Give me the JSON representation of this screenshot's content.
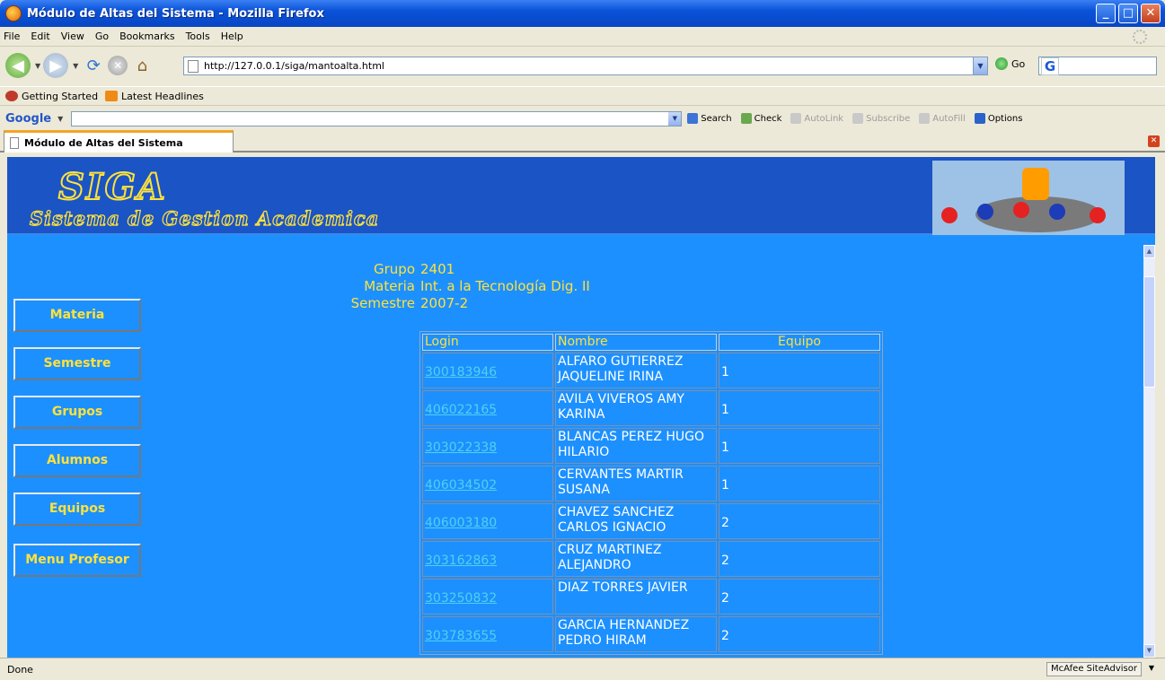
{
  "window": {
    "title": "Módulo de Altas del Sistema - Mozilla Firefox"
  },
  "menu": [
    "File",
    "Edit",
    "View",
    "Go",
    "Bookmarks",
    "Tools",
    "Help"
  ],
  "nav": {
    "url": "http://127.0.0.1/siga/mantoalta.html",
    "go_label": "Go"
  },
  "bookmarks": [
    "Getting Started",
    "Latest Headlines"
  ],
  "google_toolbar": {
    "logo": "Google",
    "items": [
      "Search",
      "Check",
      "AutoLink",
      "Subscribe",
      "AutoFill",
      "Options"
    ]
  },
  "tab": {
    "label": "Módulo de Altas del Sistema"
  },
  "banner": {
    "logo": "SIGA",
    "subtitle": "Sistema de Gestion Academica"
  },
  "info": {
    "grupo_label": "Grupo",
    "grupo": "2401",
    "materia_label": "Materia",
    "materia": "Int. a la Tecnología Dig. II",
    "semestre_label": "Semestre",
    "semestre": "2007-2"
  },
  "sidebar": [
    "Materia",
    "Semestre",
    "Grupos",
    "Alumnos",
    "Equipos",
    "Menu Profesor"
  ],
  "table": {
    "headers": [
      "Login",
      "Nombre",
      "Equipo"
    ],
    "rows": [
      {
        "login": "300183946",
        "nombre": "ALFARO GUTIERREZ JAQUELINE IRINA",
        "equipo": "1"
      },
      {
        "login": "406022165",
        "nombre": "AVILA VIVEROS AMY KARINA",
        "equipo": "1"
      },
      {
        "login": "303022338",
        "nombre": "BLANCAS PEREZ HUGO HILARIO",
        "equipo": "1"
      },
      {
        "login": "406034502",
        "nombre": "CERVANTES MARTIR SUSANA",
        "equipo": "1"
      },
      {
        "login": "406003180",
        "nombre": "CHAVEZ SANCHEZ CARLOS IGNACIO",
        "equipo": "2"
      },
      {
        "login": "303162863",
        "nombre": "CRUZ MARTINEZ ALEJANDRO",
        "equipo": "2"
      },
      {
        "login": "303250832",
        "nombre": "DIAZ TORRES JAVIER",
        "equipo": "2"
      },
      {
        "login": "303783655",
        "nombre": "GARCIA HERNANDEZ PEDRO HIRAM",
        "equipo": "2"
      }
    ]
  },
  "status": {
    "text": "Done",
    "addon": "McAfee SiteAdvisor"
  },
  "colors": {
    "page_bg": "#1d90ff",
    "banner_bg": "#1b54c4",
    "accent": "#ffe23b",
    "link": "#4fd1f0"
  }
}
